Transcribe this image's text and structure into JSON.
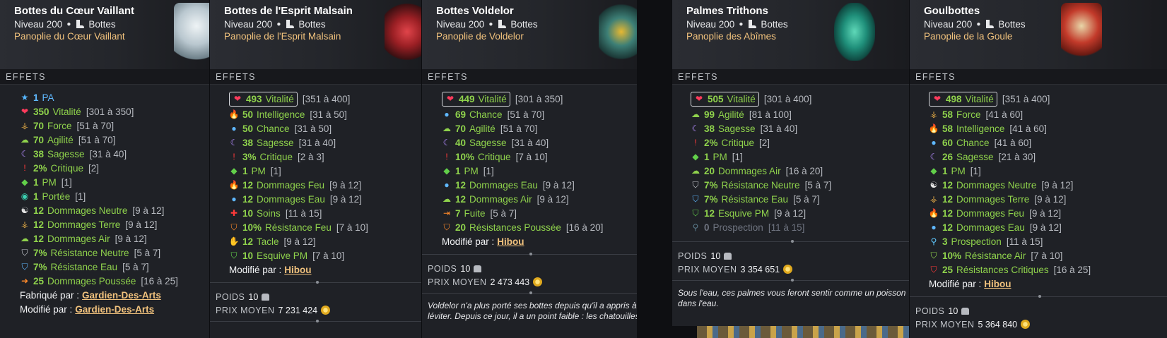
{
  "cards": [
    {
      "name": "Bottes du Cœur Vaillant",
      "level": "Niveau 200",
      "type": "Bottes",
      "set": "Panoplie du Cœur Vaillant",
      "section": "EFFETS",
      "art_color": "#cfd8de",
      "effects": [
        {
          "icon": "pa-star-icon",
          "value": "1",
          "label": "PA",
          "range": ""
        },
        {
          "icon": "heart-icon",
          "value": "350",
          "label": "Vitalité",
          "range": "[301 à 350]"
        },
        {
          "icon": "earth-icon",
          "value": "70",
          "label": "Force",
          "range": "[51 à 70]"
        },
        {
          "icon": "air-icon",
          "value": "70",
          "label": "Agilité",
          "range": "[51 à 70]"
        },
        {
          "icon": "moon-icon",
          "value": "38",
          "label": "Sagesse",
          "range": "[31 à 40]"
        },
        {
          "icon": "critical-icon",
          "value": "2%",
          "label": "Critique",
          "range": "[2]"
        },
        {
          "icon": "pm-icon",
          "value": "1",
          "label": "PM",
          "range": "[1]"
        },
        {
          "icon": "eye-icon",
          "value": "1",
          "label": "Portée",
          "range": "[1]"
        },
        {
          "icon": "neutral-icon",
          "value": "12",
          "label": "Dommages Neutre",
          "range": "[9 à 12]"
        },
        {
          "icon": "earth-icon",
          "value": "12",
          "label": "Dommages Terre",
          "range": "[9 à 12]"
        },
        {
          "icon": "air-icon",
          "value": "12",
          "label": "Dommages Air",
          "range": "[9 à 12]"
        },
        {
          "icon": "shield-neutral-icon",
          "value": "7%",
          "label": "Résistance Neutre",
          "range": "[5 à 7]"
        },
        {
          "icon": "shield-water-icon",
          "value": "7%",
          "label": "Résistance Eau",
          "range": "[5 à 7]"
        },
        {
          "icon": "push-arrow-icon",
          "value": "25",
          "label": "Dommages Poussée",
          "range": "[16 à 25]"
        }
      ],
      "crafted_label": "Fabriqué par :",
      "crafted_by": "Gardien-Des-Arts",
      "modified_label": "Modifié par :",
      "modified_by": "Gardien-Des-Arts"
    },
    {
      "name": "Bottes de l'Esprit Malsain",
      "level": "Niveau 200",
      "type": "Bottes",
      "set": "Panoplie de l'Esprit Malsain",
      "section": "EFFETS",
      "art_color": "#b3282b",
      "effects": [
        {
          "icon": "heart-icon",
          "value": "493",
          "label": "Vitalité",
          "range": "[351 à 400]",
          "boxed": true
        },
        {
          "icon": "fire-icon",
          "value": "50",
          "label": "Intelligence",
          "range": "[31 à 50]"
        },
        {
          "icon": "water-icon",
          "value": "50",
          "label": "Chance",
          "range": "[31 à 50]"
        },
        {
          "icon": "moon-icon",
          "value": "38",
          "label": "Sagesse",
          "range": "[31 à 40]"
        },
        {
          "icon": "critical-icon",
          "value": "3%",
          "label": "Critique",
          "range": "[2 à 3]"
        },
        {
          "icon": "pm-icon",
          "value": "1",
          "label": "PM",
          "range": "[1]"
        },
        {
          "icon": "fire-icon",
          "value": "12",
          "label": "Dommages Feu",
          "range": "[9 à 12]"
        },
        {
          "icon": "water-icon",
          "value": "12",
          "label": "Dommages Eau",
          "range": "[9 à 12]"
        },
        {
          "icon": "heal-cross-icon",
          "value": "10",
          "label": "Soins",
          "range": "[11 à 15]"
        },
        {
          "icon": "shield-fire-icon",
          "value": "10%",
          "label": "Résistance Feu",
          "range": "[7 à 10]"
        },
        {
          "icon": "tackle-icon",
          "value": "12",
          "label": "Tacle",
          "range": "[9 à 12]"
        },
        {
          "icon": "shield-pm-icon",
          "value": "10",
          "label": "Esquive PM",
          "range": "[7 à 10]"
        }
      ],
      "modified_label": "Modifié par :",
      "modified_by": "Hibou",
      "weight_label": "POIDS",
      "weight": "10",
      "price_label": "PRIX MOYEN",
      "price": "7 231 424"
    },
    {
      "name": "Bottes Voldelor",
      "level": "Niveau 200",
      "type": "Bottes",
      "set": "Panoplie de Voldelor",
      "section": "EFFETS",
      "art_color": "#2f6f6a",
      "effects": [
        {
          "icon": "heart-icon",
          "value": "449",
          "label": "Vitalité",
          "range": "[301 à 350]",
          "boxed": true
        },
        {
          "icon": "water-icon",
          "value": "69",
          "label": "Chance",
          "range": "[51 à 70]"
        },
        {
          "icon": "air-icon",
          "value": "70",
          "label": "Agilité",
          "range": "[51 à 70]"
        },
        {
          "icon": "moon-icon",
          "value": "40",
          "label": "Sagesse",
          "range": "[31 à 40]"
        },
        {
          "icon": "critical-icon",
          "value": "10%",
          "label": "Critique",
          "range": "[7 à 10]"
        },
        {
          "icon": "pm-icon",
          "value": "1",
          "label": "PM",
          "range": "[1]"
        },
        {
          "icon": "water-icon",
          "value": "12",
          "label": "Dommages Eau",
          "range": "[9 à 12]"
        },
        {
          "icon": "air-icon",
          "value": "12",
          "label": "Dommages Air",
          "range": "[9 à 12]"
        },
        {
          "icon": "flee-icon",
          "value": "7",
          "label": "Fuite",
          "range": "[5 à 7]"
        },
        {
          "icon": "shield-push-icon",
          "value": "20",
          "label": "Résistances Poussée",
          "range": "[16 à 20]"
        }
      ],
      "modified_label": "Modifié par :",
      "modified_by": "Hibou",
      "weight_label": "POIDS",
      "weight": "10",
      "price_label": "PRIX MOYEN",
      "price": "2 473 443",
      "description_1": "Voldelor n'a plus porté ses bottes depuis qu'il a appris à",
      "description_2": "léviter. Depuis ce jour, il a un point faible : les chatouilles."
    },
    {
      "name": "Palmes Trithons",
      "level": "Niveau 200",
      "type": "Bottes",
      "set": "Panoplie des Abîmes",
      "section": "EFFETS",
      "art_color": "#1f8f7a",
      "effects": [
        {
          "icon": "heart-icon",
          "value": "505",
          "label": "Vitalité",
          "range": "[301 à 400]",
          "boxed": true
        },
        {
          "icon": "air-icon",
          "value": "99",
          "label": "Agilité",
          "range": "[81 à 100]"
        },
        {
          "icon": "moon-icon",
          "value": "38",
          "label": "Sagesse",
          "range": "[31 à 40]"
        },
        {
          "icon": "critical-icon",
          "value": "2%",
          "label": "Critique",
          "range": "[2]"
        },
        {
          "icon": "pm-icon",
          "value": "1",
          "label": "PM",
          "range": "[1]"
        },
        {
          "icon": "air-icon",
          "value": "20",
          "label": "Dommages Air",
          "range": "[16 à 20]"
        },
        {
          "icon": "shield-neutral-icon",
          "value": "7%",
          "label": "Résistance Neutre",
          "range": "[5 à 7]"
        },
        {
          "icon": "shield-water-icon",
          "value": "7%",
          "label": "Résistance Eau",
          "range": "[5 à 7]"
        },
        {
          "icon": "shield-pm-icon",
          "value": "12",
          "label": "Esquive PM",
          "range": "[9 à 12]"
        },
        {
          "icon": "prospection-icon",
          "value": "0",
          "label": "Prospection",
          "range": "[11 à 15]",
          "dim": true
        }
      ],
      "weight_label": "POIDS",
      "weight": "10",
      "price_label": "PRIX MOYEN",
      "price": "3 354 651",
      "description_1": "Sous l'eau, ces palmes vous feront sentir comme un poisson",
      "description_2": "dans l'eau."
    },
    {
      "name": "Goulbottes",
      "level": "Niveau 200",
      "type": "Bottes",
      "set": "Panoplie de la Goule",
      "section": "EFFETS",
      "art_color": "#c23a2a",
      "effects": [
        {
          "icon": "heart-icon",
          "value": "498",
          "label": "Vitalité",
          "range": "[351 à 400]",
          "boxed": true
        },
        {
          "icon": "earth-icon",
          "value": "58",
          "label": "Force",
          "range": "[41 à 60]"
        },
        {
          "icon": "fire-icon",
          "value": "58",
          "label": "Intelligence",
          "range": "[41 à 60]"
        },
        {
          "icon": "water-icon",
          "value": "60",
          "label": "Chance",
          "range": "[41 à 60]"
        },
        {
          "icon": "moon-icon",
          "value": "26",
          "label": "Sagesse",
          "range": "[21 à 30]"
        },
        {
          "icon": "pm-icon",
          "value": "1",
          "label": "PM",
          "range": "[1]"
        },
        {
          "icon": "neutral-icon",
          "value": "12",
          "label": "Dommages Neutre",
          "range": "[9 à 12]"
        },
        {
          "icon": "earth-icon",
          "value": "12",
          "label": "Dommages Terre",
          "range": "[9 à 12]"
        },
        {
          "icon": "fire-icon",
          "value": "12",
          "label": "Dommages Feu",
          "range": "[9 à 12]"
        },
        {
          "icon": "water-icon",
          "value": "12",
          "label": "Dommages Eau",
          "range": "[9 à 12]"
        },
        {
          "icon": "prospection-icon",
          "value": "3",
          "label": "Prospection",
          "range": "[11 à 15]"
        },
        {
          "icon": "shield-air-icon",
          "value": "10%",
          "label": "Résistance Air",
          "range": "[7 à 10]"
        },
        {
          "icon": "shield-crit-icon",
          "value": "25",
          "label": "Résistances Critiques",
          "range": "[16 à 25]"
        }
      ],
      "modified_label": "Modifié par :",
      "modified_by": "Hibou",
      "weight_label": "POIDS",
      "weight": "10",
      "price_label": "PRIX MOYEN",
      "price": "5 364 840"
    }
  ]
}
